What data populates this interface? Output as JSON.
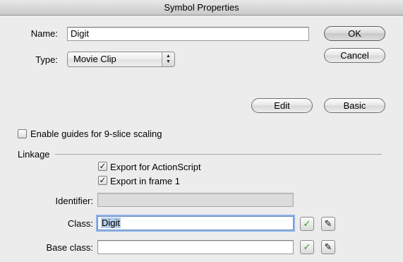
{
  "window": {
    "title": "Symbol Properties"
  },
  "name": {
    "label": "Name:",
    "value": "Digit"
  },
  "type": {
    "label": "Type:",
    "value": "Movie Clip"
  },
  "buttons": {
    "ok": "OK",
    "cancel": "Cancel",
    "edit": "Edit",
    "basic": "Basic"
  },
  "guides": {
    "label": "Enable guides for 9-slice scaling",
    "checked": false
  },
  "linkage": {
    "header": "Linkage",
    "export_actionscript": {
      "label": "Export for ActionScript",
      "checked": true
    },
    "export_frame1": {
      "label": "Export in frame 1",
      "checked": true
    },
    "identifier": {
      "label": "Identifier:",
      "value": ""
    },
    "class": {
      "label": "Class:",
      "value": "Digit"
    },
    "base_class": {
      "label": "Base class:",
      "value": ""
    }
  },
  "icons": {
    "validate": "checkmark-icon",
    "edit": "pencil-icon"
  },
  "colors": {
    "check_green": "#2f9a26",
    "focus_ring": "#8fb2e6",
    "selection": "#b4cde8"
  }
}
